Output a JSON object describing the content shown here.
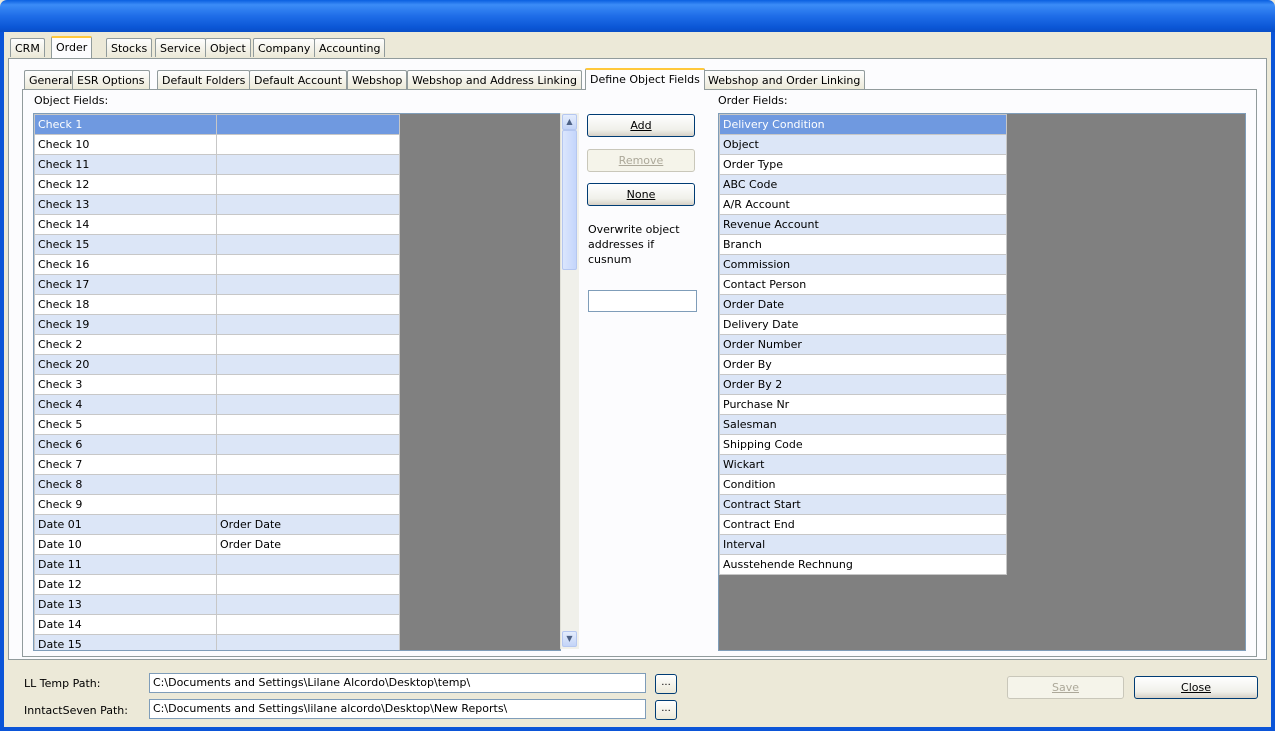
{
  "main_tabs": [
    "CRM",
    "Order",
    "Stocks",
    "Service",
    "Object",
    "Company",
    "Accounting"
  ],
  "main_active": "Order",
  "sub_tabs": [
    "General",
    "ESR Options",
    "Default Folders",
    "Default Account",
    "Webshop",
    "Webshop and Address Linking",
    "Define Object Fields",
    "Webshop and Order Linking"
  ],
  "sub_active": "Define Object Fields",
  "object_fields": {
    "label": "Object Fields:",
    "rows": [
      {
        "name": "Check 1",
        "value": ""
      },
      {
        "name": "Check 10",
        "value": ""
      },
      {
        "name": "Check 11",
        "value": ""
      },
      {
        "name": "Check 12",
        "value": ""
      },
      {
        "name": "Check 13",
        "value": ""
      },
      {
        "name": "Check 14",
        "value": ""
      },
      {
        "name": "Check 15",
        "value": ""
      },
      {
        "name": "Check 16",
        "value": ""
      },
      {
        "name": "Check 17",
        "value": ""
      },
      {
        "name": "Check 18",
        "value": ""
      },
      {
        "name": "Check 19",
        "value": ""
      },
      {
        "name": "Check 2",
        "value": ""
      },
      {
        "name": "Check 20",
        "value": ""
      },
      {
        "name": "Check 3",
        "value": ""
      },
      {
        "name": "Check 4",
        "value": ""
      },
      {
        "name": "Check 5",
        "value": ""
      },
      {
        "name": "Check 6",
        "value": ""
      },
      {
        "name": "Check 7",
        "value": ""
      },
      {
        "name": "Check 8",
        "value": ""
      },
      {
        "name": "Check 9",
        "value": ""
      },
      {
        "name": "Date 01",
        "value": "Order Date"
      },
      {
        "name": "Date 10",
        "value": "Order Date"
      },
      {
        "name": "Date 11",
        "value": ""
      },
      {
        "name": "Date 12",
        "value": ""
      },
      {
        "name": "Date 13",
        "value": ""
      },
      {
        "name": "Date 14",
        "value": ""
      },
      {
        "name": "Date 15",
        "value": ""
      }
    ]
  },
  "buttons": {
    "add": "Add",
    "remove": "Remove",
    "none": "None"
  },
  "overwrite_label": "Overwrite object addresses if cusnum",
  "overwrite_value": "",
  "order_fields": {
    "label": "Order Fields:",
    "rows": [
      "Delivery Condition",
      "Object",
      "Order Type",
      "ABC Code",
      "A/R Account",
      "Revenue Account",
      "Branch",
      "Commission",
      "Contact Person",
      "Order Date",
      "Delivery Date",
      "Order Number",
      "Order By",
      "Order By 2",
      "Purchase Nr",
      "Salesman",
      "Shipping Code",
      "Wickart",
      "Condition",
      "Contract Start",
      "Contract End",
      "Interval",
      "Ausstehende Rechnung"
    ]
  },
  "paths": {
    "ll_temp_label": "LL Temp Path:",
    "ll_temp_value": "C:\\Documents and Settings\\Lilane Alcordo\\Desktop\\temp\\",
    "inntact_label": "InntactSeven Path:",
    "inntact_value": "C:\\Documents and Settings\\lilane alcordo\\Desktop\\New Reports\\",
    "browse_label": "..."
  },
  "footer": {
    "save": "Save",
    "close": "Close"
  },
  "colors": {
    "title_bar": "#1f6de8",
    "selected_row": "#6f99e0",
    "alt_row": "#dce6f7",
    "grid_bg": "#808080"
  }
}
